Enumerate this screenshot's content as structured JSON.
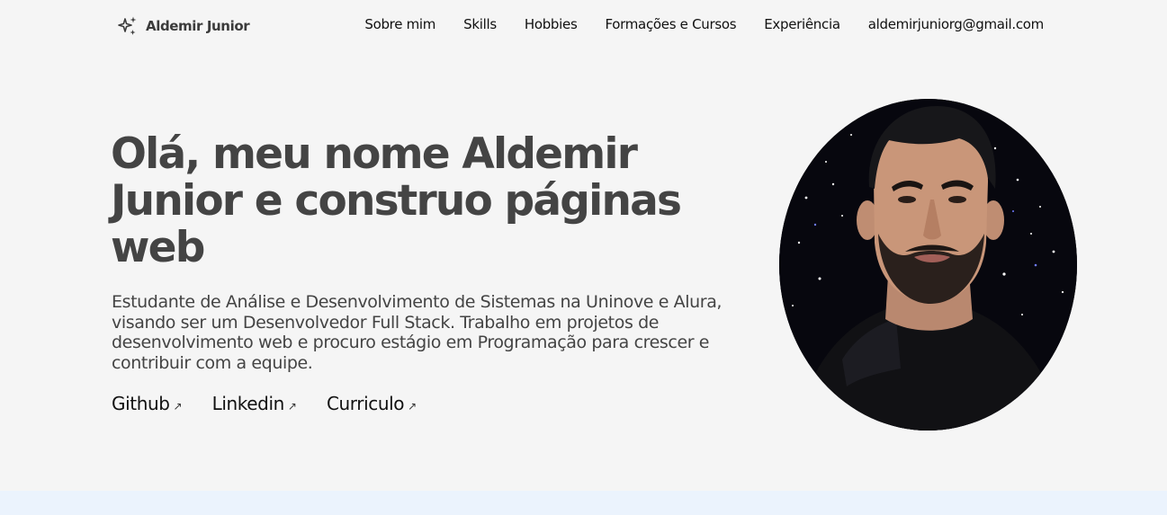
{
  "brand": {
    "name": "Aldemir Junior",
    "icon": "sparkles-icon"
  },
  "nav": {
    "items": [
      {
        "label": "Sobre mim"
      },
      {
        "label": "Skills"
      },
      {
        "label": "Hobbies"
      },
      {
        "label": "Formações e Cursos"
      },
      {
        "label": "Experiência"
      },
      {
        "label": "aldemirjuniorg@gmail.com"
      }
    ]
  },
  "hero": {
    "title": "Olá, meu nome Aldemir Junior e construo páginas web",
    "description": "Estudante de Análise e Desenvolvimento de Sistemas na Uninove e Alura, visando ser um Desenvolvedor Full Stack. Trabalho em projetos de desenvolvimento web e procuro estágio em Programação para crescer e contribuir com a equipe.",
    "links": [
      {
        "label": "Github",
        "icon": "arrow-up-right-icon"
      },
      {
        "label": "Linkedin",
        "icon": "arrow-up-right-icon"
      },
      {
        "label": "Curriculo",
        "icon": "arrow-up-right-icon"
      }
    ],
    "photo_icon": "profile-photo"
  },
  "colors": {
    "background": "#f5f5f5",
    "heading": "#444444",
    "text": "#111111",
    "next_section_background": "#ebf3fd"
  }
}
